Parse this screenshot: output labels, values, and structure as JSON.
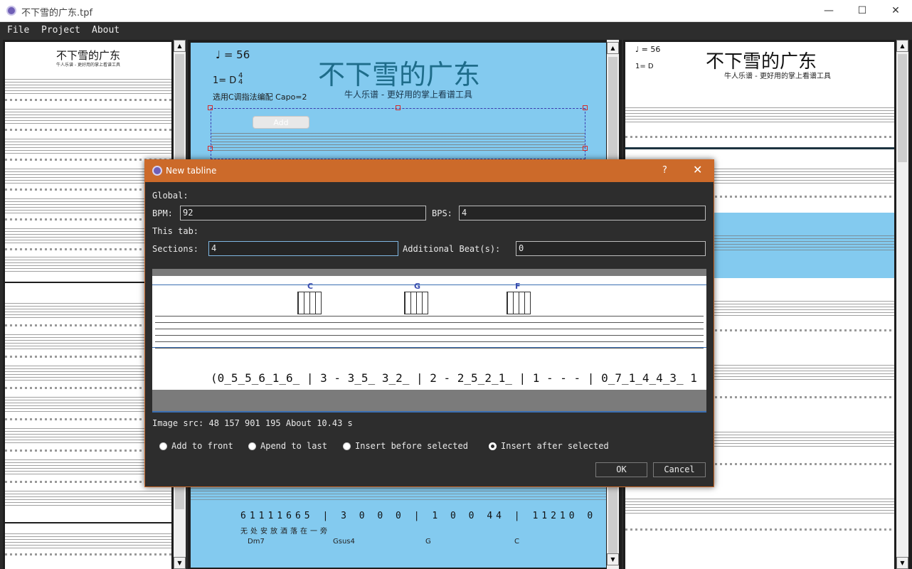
{
  "window": {
    "title": "不下雪的广东.tpf",
    "minimize": "—",
    "maximize": "☐",
    "close": "✕"
  },
  "menu": {
    "items": [
      "File",
      "Project",
      "About"
    ]
  },
  "sheet": {
    "tempo": "♩ = 56",
    "key": "1= D",
    "time_sig_top": "4",
    "time_sig_bottom": "4",
    "capo": "选用C调指法编配 Capo=2",
    "title": "不下雪的广东",
    "subtitle": "牛人乐谱 - 更好用的掌上看谱工具",
    "add_label": "Add"
  },
  "left_page": {
    "title": "不下雪的广东",
    "subtitle": "牛人乐谱 - 更好用的掌上看谱工具"
  },
  "right_page": {
    "title": "不下雪的广东",
    "subtitle": "牛人乐谱 - 更好用的掌上看谱工具",
    "tempo": "♩ = 56",
    "key": "1= D"
  },
  "dialog": {
    "title": "New tabline",
    "help": "?",
    "close": "✕",
    "global_label": "Global:",
    "bpm_label": "BPM:",
    "bpm_value": "92",
    "bps_label": "BPS:",
    "bps_value": "4",
    "this_tab_label": "This tab:",
    "sections_label": "Sections:",
    "sections_value": "4",
    "additional_label": "Additional Beat(s):",
    "additional_value": "0",
    "image_src": "Image src: 48 157 901 195 About 10.43 s",
    "preview_chords": [
      "C",
      "G",
      "F"
    ],
    "preview_notation": "(0̲5̲5̲6̲1̲6̲ | 3 - 3̲5̲ 3̲2̲ | 2 - 2̲5̲2̲1̲ | 1 - - - | 0̲7̲1̲4̲4̲3̲ 1",
    "options": [
      {
        "label": "Add to front",
        "selected": false
      },
      {
        "label": "Apend to last",
        "selected": false
      },
      {
        "label": "Insert before selected",
        "selected": false
      },
      {
        "label": "Insert after selected",
        "selected": true
      }
    ],
    "ok_label": "OK",
    "cancel_label": "Cancel"
  }
}
